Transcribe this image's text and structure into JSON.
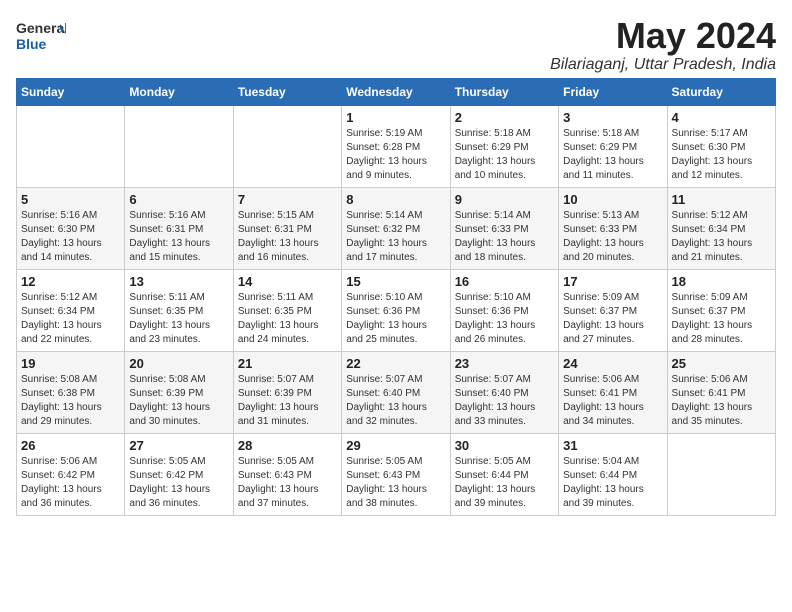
{
  "logo": {
    "general": "General",
    "blue": "Blue"
  },
  "title": {
    "month_year": "May 2024",
    "location": "Bilariaganj, Uttar Pradesh, India"
  },
  "days_of_week": [
    "Sunday",
    "Monday",
    "Tuesday",
    "Wednesday",
    "Thursday",
    "Friday",
    "Saturday"
  ],
  "weeks": [
    [
      {
        "day": "",
        "info": ""
      },
      {
        "day": "",
        "info": ""
      },
      {
        "day": "",
        "info": ""
      },
      {
        "day": "1",
        "info": "Sunrise: 5:19 AM\nSunset: 6:28 PM\nDaylight: 13 hours\nand 9 minutes."
      },
      {
        "day": "2",
        "info": "Sunrise: 5:18 AM\nSunset: 6:29 PM\nDaylight: 13 hours\nand 10 minutes."
      },
      {
        "day": "3",
        "info": "Sunrise: 5:18 AM\nSunset: 6:29 PM\nDaylight: 13 hours\nand 11 minutes."
      },
      {
        "day": "4",
        "info": "Sunrise: 5:17 AM\nSunset: 6:30 PM\nDaylight: 13 hours\nand 12 minutes."
      }
    ],
    [
      {
        "day": "5",
        "info": "Sunrise: 5:16 AM\nSunset: 6:30 PM\nDaylight: 13 hours\nand 14 minutes."
      },
      {
        "day": "6",
        "info": "Sunrise: 5:16 AM\nSunset: 6:31 PM\nDaylight: 13 hours\nand 15 minutes."
      },
      {
        "day": "7",
        "info": "Sunrise: 5:15 AM\nSunset: 6:31 PM\nDaylight: 13 hours\nand 16 minutes."
      },
      {
        "day": "8",
        "info": "Sunrise: 5:14 AM\nSunset: 6:32 PM\nDaylight: 13 hours\nand 17 minutes."
      },
      {
        "day": "9",
        "info": "Sunrise: 5:14 AM\nSunset: 6:33 PM\nDaylight: 13 hours\nand 18 minutes."
      },
      {
        "day": "10",
        "info": "Sunrise: 5:13 AM\nSunset: 6:33 PM\nDaylight: 13 hours\nand 20 minutes."
      },
      {
        "day": "11",
        "info": "Sunrise: 5:12 AM\nSunset: 6:34 PM\nDaylight: 13 hours\nand 21 minutes."
      }
    ],
    [
      {
        "day": "12",
        "info": "Sunrise: 5:12 AM\nSunset: 6:34 PM\nDaylight: 13 hours\nand 22 minutes."
      },
      {
        "day": "13",
        "info": "Sunrise: 5:11 AM\nSunset: 6:35 PM\nDaylight: 13 hours\nand 23 minutes."
      },
      {
        "day": "14",
        "info": "Sunrise: 5:11 AM\nSunset: 6:35 PM\nDaylight: 13 hours\nand 24 minutes."
      },
      {
        "day": "15",
        "info": "Sunrise: 5:10 AM\nSunset: 6:36 PM\nDaylight: 13 hours\nand 25 minutes."
      },
      {
        "day": "16",
        "info": "Sunrise: 5:10 AM\nSunset: 6:36 PM\nDaylight: 13 hours\nand 26 minutes."
      },
      {
        "day": "17",
        "info": "Sunrise: 5:09 AM\nSunset: 6:37 PM\nDaylight: 13 hours\nand 27 minutes."
      },
      {
        "day": "18",
        "info": "Sunrise: 5:09 AM\nSunset: 6:37 PM\nDaylight: 13 hours\nand 28 minutes."
      }
    ],
    [
      {
        "day": "19",
        "info": "Sunrise: 5:08 AM\nSunset: 6:38 PM\nDaylight: 13 hours\nand 29 minutes."
      },
      {
        "day": "20",
        "info": "Sunrise: 5:08 AM\nSunset: 6:39 PM\nDaylight: 13 hours\nand 30 minutes."
      },
      {
        "day": "21",
        "info": "Sunrise: 5:07 AM\nSunset: 6:39 PM\nDaylight: 13 hours\nand 31 minutes."
      },
      {
        "day": "22",
        "info": "Sunrise: 5:07 AM\nSunset: 6:40 PM\nDaylight: 13 hours\nand 32 minutes."
      },
      {
        "day": "23",
        "info": "Sunrise: 5:07 AM\nSunset: 6:40 PM\nDaylight: 13 hours\nand 33 minutes."
      },
      {
        "day": "24",
        "info": "Sunrise: 5:06 AM\nSunset: 6:41 PM\nDaylight: 13 hours\nand 34 minutes."
      },
      {
        "day": "25",
        "info": "Sunrise: 5:06 AM\nSunset: 6:41 PM\nDaylight: 13 hours\nand 35 minutes."
      }
    ],
    [
      {
        "day": "26",
        "info": "Sunrise: 5:06 AM\nSunset: 6:42 PM\nDaylight: 13 hours\nand 36 minutes."
      },
      {
        "day": "27",
        "info": "Sunrise: 5:05 AM\nSunset: 6:42 PM\nDaylight: 13 hours\nand 36 minutes."
      },
      {
        "day": "28",
        "info": "Sunrise: 5:05 AM\nSunset: 6:43 PM\nDaylight: 13 hours\nand 37 minutes."
      },
      {
        "day": "29",
        "info": "Sunrise: 5:05 AM\nSunset: 6:43 PM\nDaylight: 13 hours\nand 38 minutes."
      },
      {
        "day": "30",
        "info": "Sunrise: 5:05 AM\nSunset: 6:44 PM\nDaylight: 13 hours\nand 39 minutes."
      },
      {
        "day": "31",
        "info": "Sunrise: 5:04 AM\nSunset: 6:44 PM\nDaylight: 13 hours\nand 39 minutes."
      },
      {
        "day": "",
        "info": ""
      }
    ]
  ]
}
